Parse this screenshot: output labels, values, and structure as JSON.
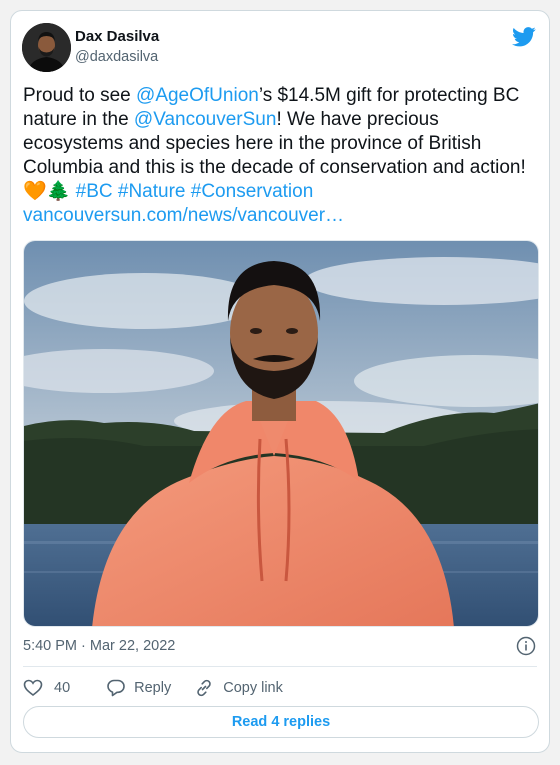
{
  "author": {
    "name": "Dax Dasilva",
    "handle": "@daxdasilva"
  },
  "tweet": {
    "t1": "Proud to see ",
    "mention1": "@AgeOfUnion",
    "t2": "’s $14.5M gift for protecting BC nature in the ",
    "mention2": "@VancouverSun",
    "t3": "! We have precious ecosystems and species here in the province of British Columbia and this is the decade of conservation and action! ",
    "emoji_heart": "🧡",
    "emoji_tree": "🌲",
    "hashtag1": "#BC",
    "hashtag2": "#Nature",
    "hashtag3": "#Conservation",
    "url": "vancouversun.com/news/vancouver…"
  },
  "meta": {
    "timestamp": "5:40 PM · Mar 22, 2022"
  },
  "actions": {
    "like_count": "40",
    "reply_label": "Reply",
    "copy_label": "Copy link"
  },
  "replies_button": "Read 4 replies",
  "colors": {
    "link": "#1d9bf0",
    "text": "#0f1419",
    "muted": "#536471",
    "border": "#cfd9de"
  },
  "icons": [
    "twitter-bird-icon",
    "info-icon",
    "heart-icon",
    "reply-icon",
    "link-icon"
  ]
}
